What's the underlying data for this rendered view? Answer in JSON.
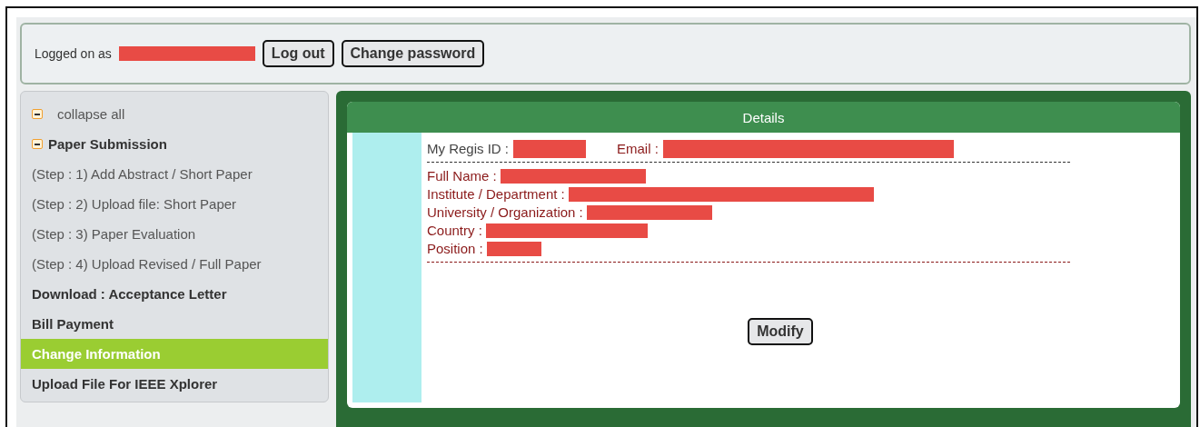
{
  "account_bar": {
    "label": "Logged on as",
    "username_redacted": true,
    "buttons": [
      "Log out",
      "Change password"
    ]
  },
  "sidebar": {
    "items": [
      {
        "label": "collapse all",
        "kind": "toggle",
        "expanded": true,
        "selected": false
      },
      {
        "label": "Paper Submission",
        "kind": "group",
        "expanded": true,
        "selected": false
      },
      {
        "label": "(Step : 1) Add Abstract / Short Paper",
        "kind": "step",
        "selected": false
      },
      {
        "label": "(Step : 2) Upload file: Short Paper",
        "kind": "step",
        "selected": false
      },
      {
        "label": "(Step : 3) Paper Evaluation",
        "kind": "step",
        "selected": false
      },
      {
        "label": "(Step : 4) Upload Revised / Full Paper",
        "kind": "step",
        "selected": false
      },
      {
        "label": "Download : Acceptance Letter",
        "kind": "link",
        "selected": false
      },
      {
        "label": "Bill Payment",
        "kind": "link",
        "selected": false
      },
      {
        "label": "Change Information",
        "kind": "link",
        "selected": true
      },
      {
        "label": "Upload File For IEEE Xplorer",
        "kind": "link",
        "selected": false
      }
    ]
  },
  "details": {
    "title": "Details",
    "top_fields": [
      {
        "label": "My Regis ID :",
        "kind": "plain",
        "redacted": true
      },
      {
        "label": "Email :",
        "kind": "accent",
        "redacted": true
      }
    ],
    "fields": [
      {
        "label": "Full Name :",
        "redacted": true
      },
      {
        "label": "Institute / Department  :",
        "redacted": true
      },
      {
        "label": "University / Organization :",
        "redacted": true
      },
      {
        "label": "Country :",
        "redacted": true
      },
      {
        "label": "Position :",
        "redacted": true
      }
    ],
    "button": "Modify"
  }
}
